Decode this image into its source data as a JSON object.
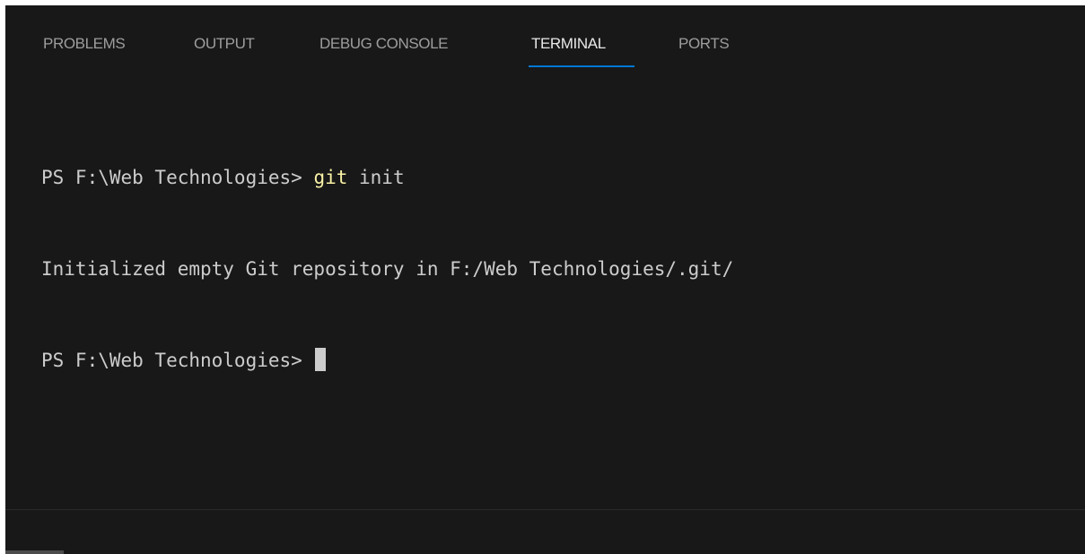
{
  "tabs": [
    {
      "label": "PROBLEMS"
    },
    {
      "label": "OUTPUT"
    },
    {
      "label": "DEBUG CONSOLE"
    },
    {
      "label": "TERMINAL",
      "active": true
    },
    {
      "label": "PORTS"
    }
  ],
  "terminal": {
    "line1_prompt": "PS F:\\Web Technologies> ",
    "line1_cmd": "git",
    "line1_args": " init",
    "line2_output": "Initialized empty Git repository in F:/Web Technologies/.git/",
    "line3_prompt": "PS F:\\Web Technologies> "
  },
  "colors": {
    "panel_background": "#181818",
    "active_tab_underline": "#0078d4",
    "command_highlight": "#f9f1a5",
    "terminal_text": "#cccccc"
  }
}
